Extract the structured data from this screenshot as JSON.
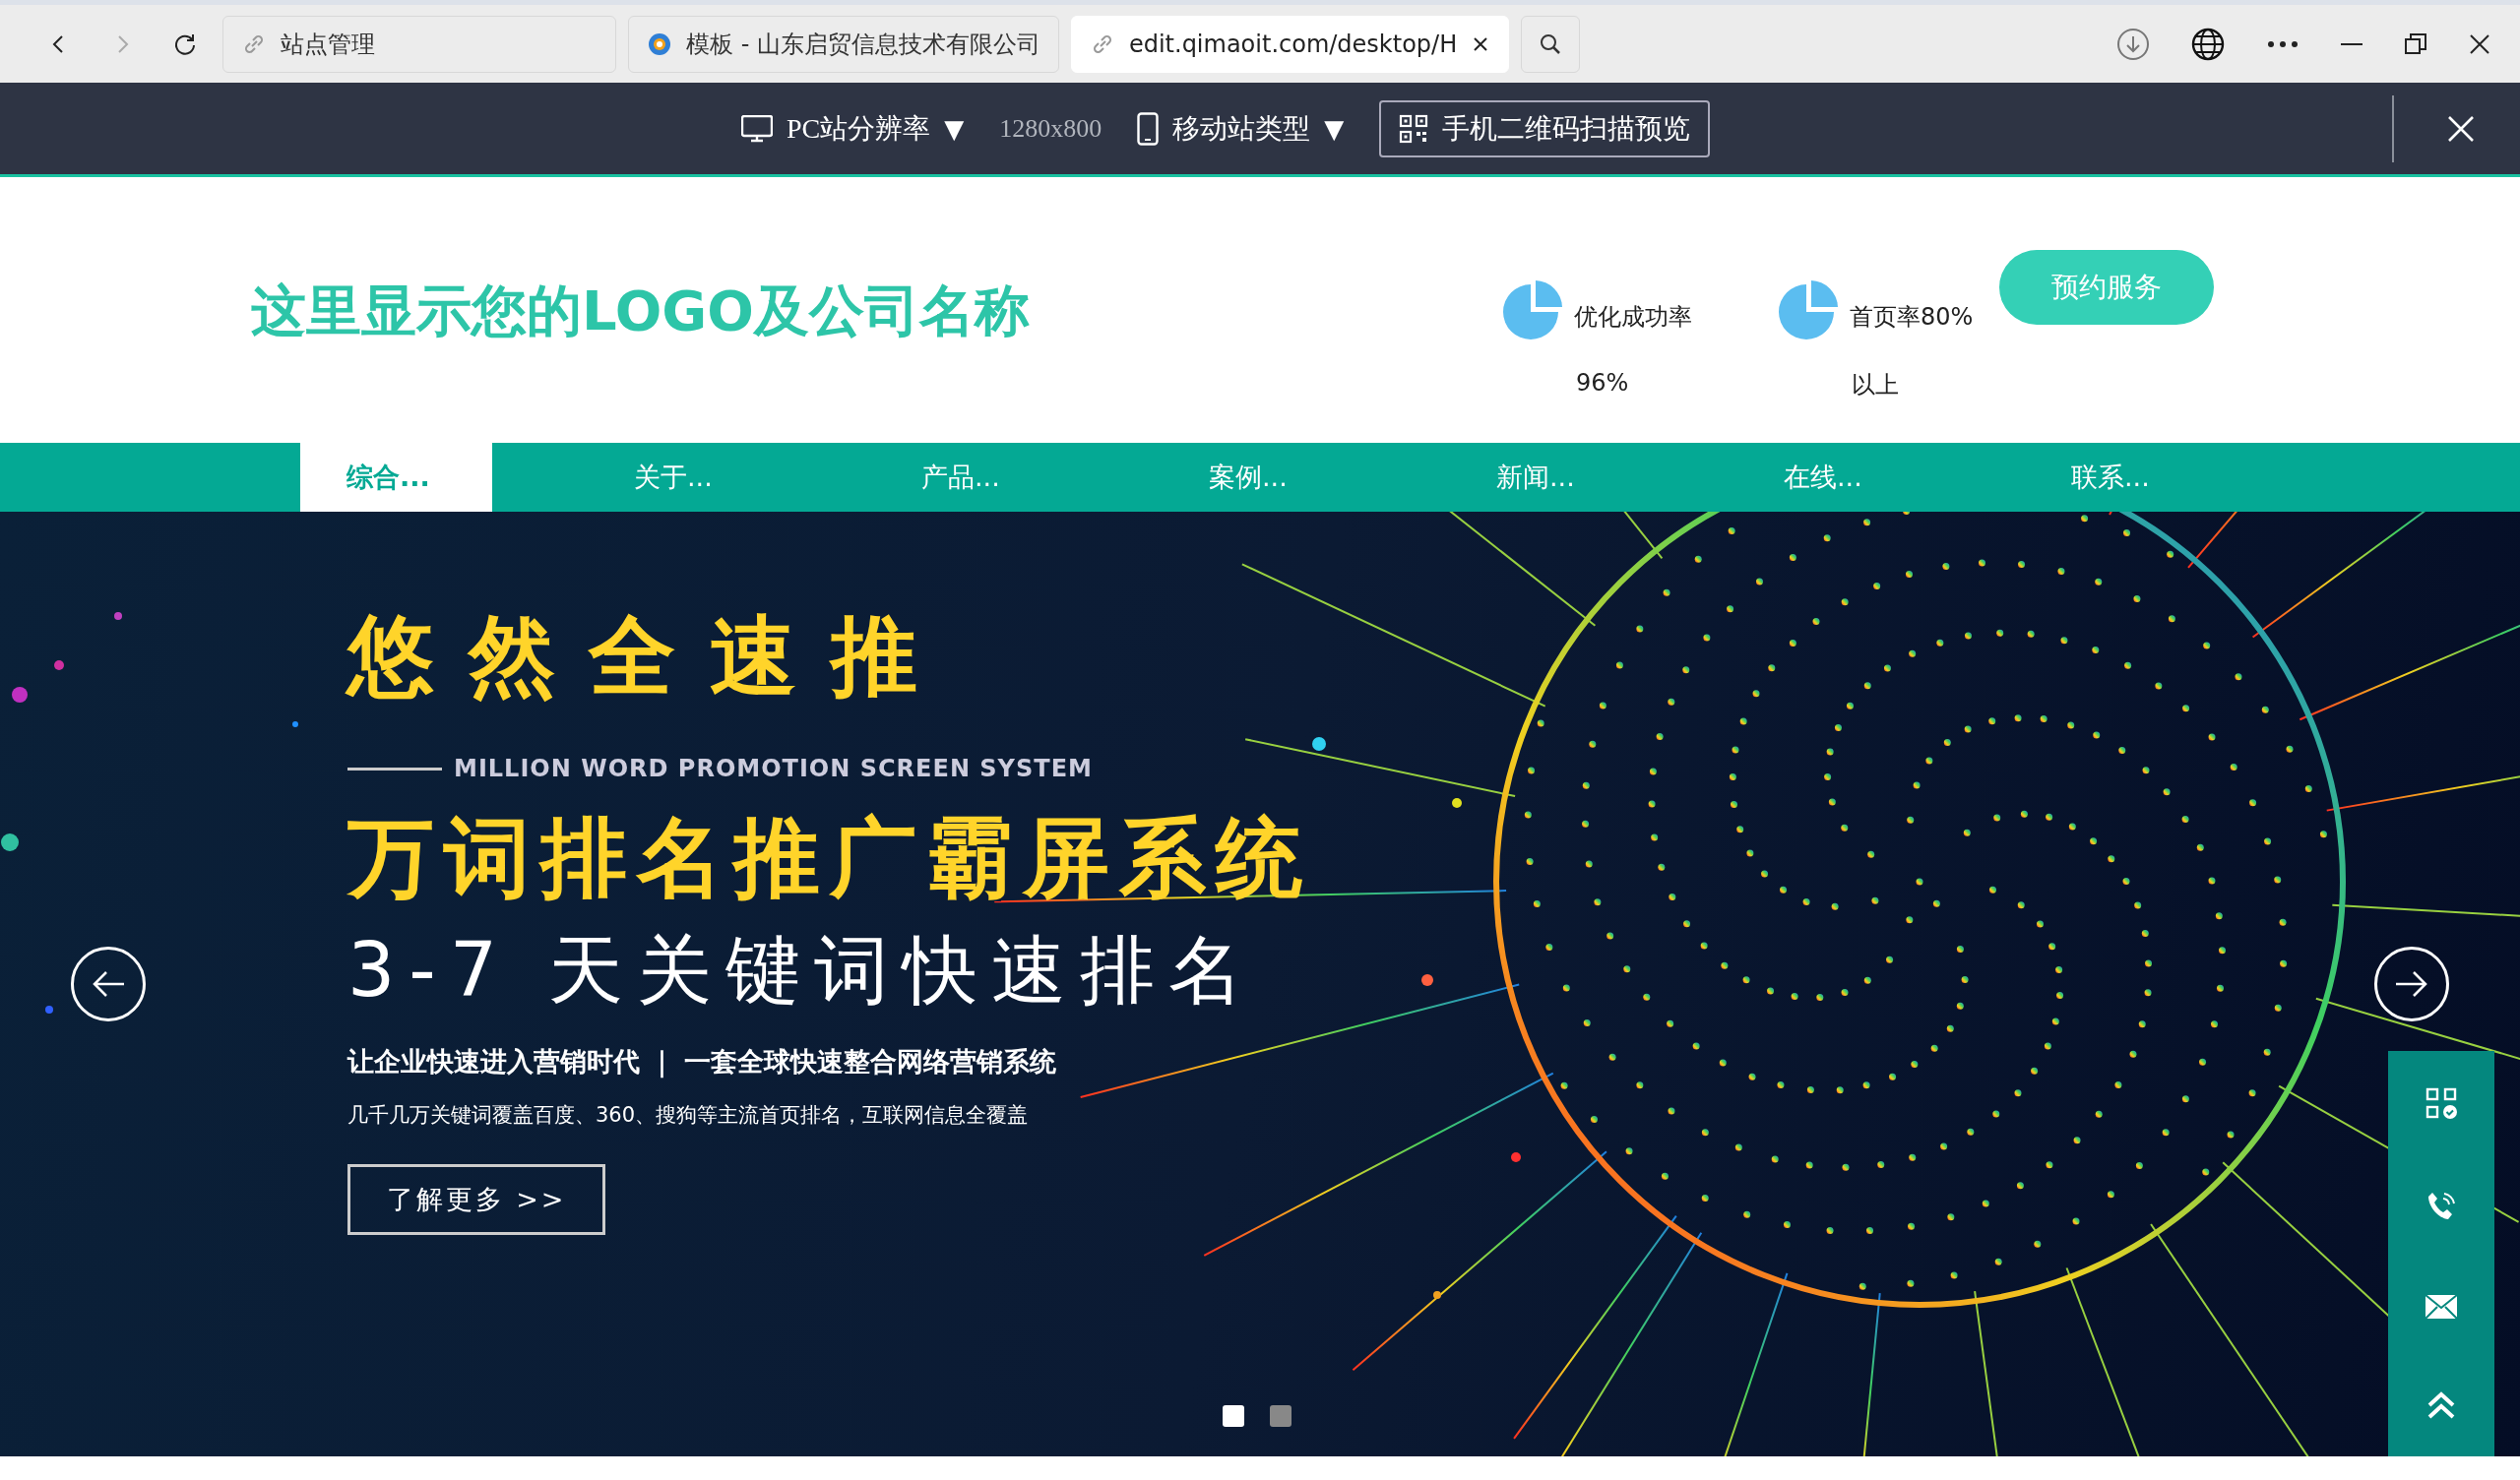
{
  "browser": {
    "tabs": [
      {
        "title": "站点管理",
        "selected": false
      },
      {
        "title": "模板 - 山东启贸信息技术有限公司",
        "selected": false
      },
      {
        "title": "edit.qimaoit.com/desktop/H",
        "selected": true
      }
    ]
  },
  "toolbar": {
    "pc_resolution": "PC站分辨率",
    "resolution": "1280x800",
    "mobile_type": "移动站类型",
    "dropdown_glyph": "▼",
    "qr_preview": "手机二维码扫描预览"
  },
  "header": {
    "logo": "这里显示您的LOGO及公司名称",
    "stats": [
      {
        "label": "优化成功率",
        "value": "96%"
      },
      {
        "label": "首页率80%",
        "value": "以上"
      }
    ],
    "button": "预约服务"
  },
  "nav": [
    {
      "label": "综合...",
      "selected": true
    },
    {
      "label": "关于...",
      "selected": false
    },
    {
      "label": "产品...",
      "selected": false
    },
    {
      "label": "案例...",
      "selected": false
    },
    {
      "label": "新闻...",
      "selected": false
    },
    {
      "label": "在线...",
      "selected": false
    },
    {
      "label": "联系...",
      "selected": false
    }
  ],
  "banner": {
    "brand": "悠 然 全 速 推",
    "subtitle_en": "MILLION WORD PROMOTION SCREEN SYSTEM",
    "headline": "万词排名推广霸屏系统",
    "subheadline": "3-7 天关键词快速排名",
    "tagline": "让企业快速进入营销时代 ｜ 一套全球快速整合网络营销系统",
    "description": "几千几万关键词覆盖百度、360、搜狗等主流首页排名，互联网信息全覆盖",
    "cta": "了解更多 >>",
    "dots": [
      {
        "selected": true
      },
      {
        "selected": false
      }
    ]
  }
}
